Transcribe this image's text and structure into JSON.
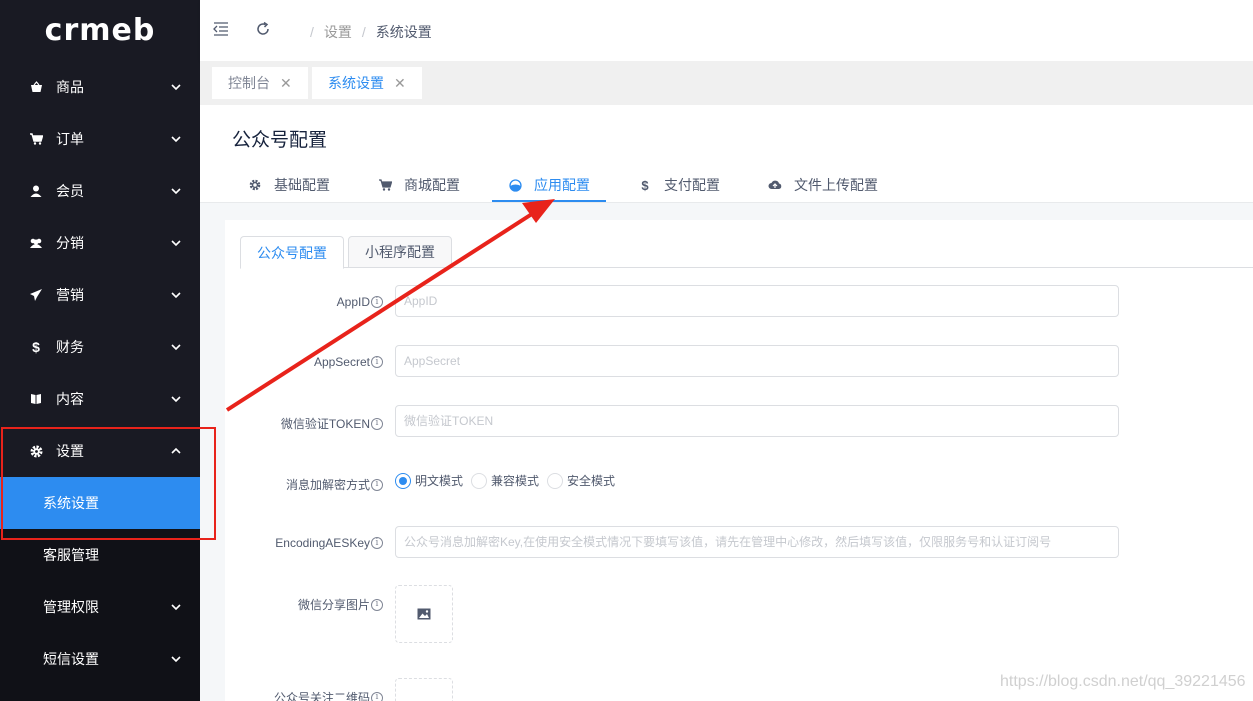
{
  "logo": {
    "text": "crmeb"
  },
  "sidebar": {
    "items": [
      {
        "label": "商品",
        "icon": "bag-icon"
      },
      {
        "label": "订单",
        "icon": "cart-icon"
      },
      {
        "label": "会员",
        "icon": "user-icon"
      },
      {
        "label": "分销",
        "icon": "group-icon"
      },
      {
        "label": "营销",
        "icon": "send-icon"
      },
      {
        "label": "财务",
        "icon": "dollar-icon"
      },
      {
        "label": "内容",
        "icon": "book-icon"
      },
      {
        "label": "设置",
        "icon": "gear-icon"
      }
    ],
    "sub_items": [
      {
        "label": "系统设置"
      },
      {
        "label": "客服管理"
      },
      {
        "label": "管理权限"
      },
      {
        "label": "短信设置"
      }
    ]
  },
  "header": {
    "breadcrumb": {
      "sep": "/",
      "level1": "设置",
      "level2": "系统设置"
    }
  },
  "tags": [
    {
      "label": "控制台",
      "close": "✕"
    },
    {
      "label": "系统设置",
      "close": "✕"
    }
  ],
  "page": {
    "title": "公众号配置",
    "tabs": [
      {
        "label": "基础配置",
        "icon": "gear-icon"
      },
      {
        "label": "商城配置",
        "icon": "cart-icon"
      },
      {
        "label": "应用配置",
        "icon": "app-icon"
      },
      {
        "label": "支付配置",
        "icon": "dollar-icon"
      },
      {
        "label": "文件上传配置",
        "icon": "cloud-upload-icon"
      }
    ]
  },
  "inner_tabs": [
    {
      "label": "公众号配置"
    },
    {
      "label": "小程序配置"
    }
  ],
  "form": {
    "appid": {
      "label": "AppID",
      "placeholder": "AppID",
      "value": ""
    },
    "appsecret": {
      "label": "AppSecret",
      "placeholder": "AppSecret",
      "value": ""
    },
    "token": {
      "label": "微信验证TOKEN",
      "placeholder": "微信验证TOKEN",
      "value": ""
    },
    "encrypt": {
      "label": "消息加解密方式",
      "options": [
        "明文模式",
        "兼容模式",
        "安全模式"
      ],
      "selected": "明文模式"
    },
    "aeskey": {
      "label": "EncodingAESKey",
      "placeholder": "公众号消息加解密Key,在使用安全模式情况下要填写该值，请先在管理中心修改，然后填写该值，仅限服务号和认证订阅号",
      "value": ""
    },
    "share_image": {
      "label": "微信分享图片"
    },
    "qrcode": {
      "label": "公众号关注二维码"
    },
    "info_glyph": "i"
  },
  "watermark": "https://blog.csdn.net/qq_39221456",
  "colors": {
    "accent": "#2d8cf0",
    "sidebar_bg": "#191a23",
    "annotation_red": "#e8231b"
  }
}
